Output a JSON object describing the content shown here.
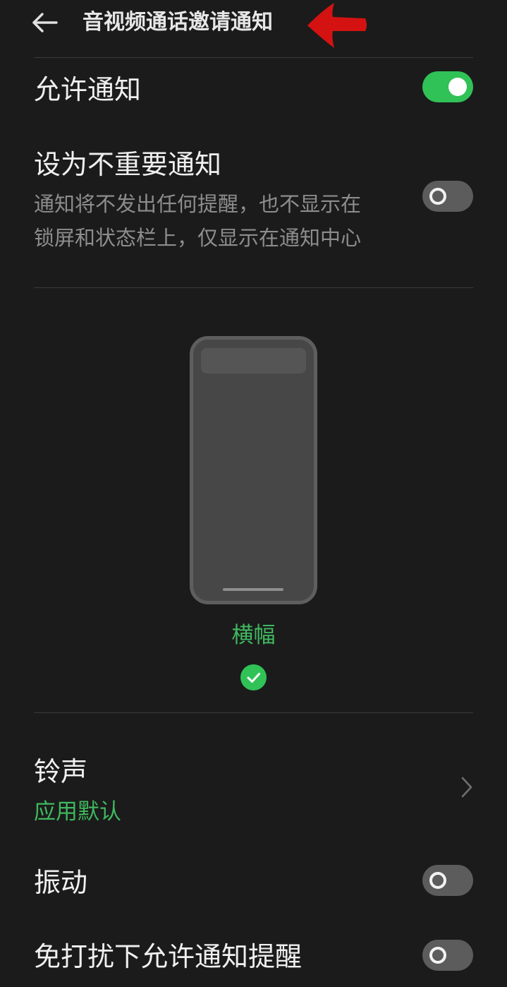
{
  "header": {
    "title": "音视频通话邀请通知"
  },
  "settings": {
    "allow_notifications": {
      "title": "允许通知",
      "enabled": true
    },
    "unimportant": {
      "title": "设为不重要通知",
      "desc_line1": "通知将不发出任何提醒，也不显示在",
      "desc_line2": "锁屏和状态栏上，仅显示在通知中心",
      "enabled": false
    },
    "style": {
      "selected_label": "横幅",
      "selected": true
    },
    "ringtone": {
      "title": "铃声",
      "value": "应用默认"
    },
    "vibration": {
      "title": "振动",
      "enabled": false
    },
    "dnd_allow": {
      "title": "免打扰下允许通知提醒",
      "enabled": false
    }
  },
  "colors": {
    "background": "#1b1b1b",
    "accent_green": "#30c257",
    "annotation_red": "#d41212"
  },
  "icons": {
    "back": "back-arrow-icon",
    "annotation": "red-arrow-annotation",
    "check": "check-circle-icon",
    "chevron": "chevron-right-icon"
  }
}
